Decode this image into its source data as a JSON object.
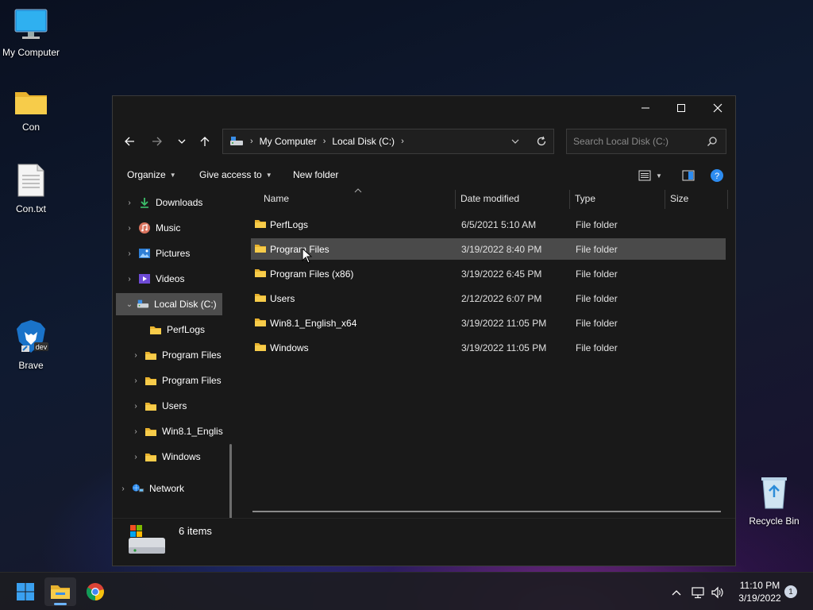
{
  "desktop": {
    "icons": [
      {
        "label": "My Computer"
      },
      {
        "label": "Con"
      },
      {
        "label": "Con.txt"
      },
      {
        "label": "Brave",
        "tag": "dev"
      },
      {
        "label": "Recycle Bin"
      }
    ]
  },
  "window": {
    "address": {
      "crumbs": [
        "My Computer",
        "Local Disk (C:)"
      ]
    },
    "search": {
      "placeholder": "Search Local Disk (C:)"
    },
    "toolbar": {
      "organize": "Organize",
      "give_access": "Give access to",
      "new_folder": "New folder"
    },
    "sidebar": {
      "items": [
        {
          "label": "Downloads",
          "icon": "download-icon"
        },
        {
          "label": "Music",
          "icon": "music-icon"
        },
        {
          "label": "Pictures",
          "icon": "pictures-icon"
        },
        {
          "label": "Videos",
          "icon": "videos-icon"
        },
        {
          "label": "Local Disk (C:)",
          "icon": "drive-icon",
          "selected": true,
          "expanded": true
        },
        {
          "label": "PerfLogs",
          "icon": "folder-icon"
        },
        {
          "label": "Program Files",
          "icon": "folder-icon"
        },
        {
          "label": "Program Files",
          "icon": "folder-icon"
        },
        {
          "label": "Users",
          "icon": "folder-icon"
        },
        {
          "label": "Win8.1_Englis",
          "icon": "folder-icon"
        },
        {
          "label": "Windows",
          "icon": "folder-icon"
        },
        {
          "label": "Network",
          "icon": "network-icon"
        }
      ]
    },
    "columns": {
      "name": "Name",
      "date": "Date modified",
      "type": "Type",
      "size": "Size"
    },
    "files": [
      {
        "name": "PerfLogs",
        "date": "6/5/2021 5:10 AM",
        "type": "File folder"
      },
      {
        "name": "Program Files",
        "date": "3/19/2022 8:40 PM",
        "type": "File folder"
      },
      {
        "name": "Program Files (x86)",
        "date": "3/19/2022 6:45 PM",
        "type": "File folder"
      },
      {
        "name": "Users",
        "date": "2/12/2022 6:07 PM",
        "type": "File folder"
      },
      {
        "name": "Win8.1_English_x64",
        "date": "3/19/2022 11:05 PM",
        "type": "File folder"
      },
      {
        "name": "Windows",
        "date": "3/19/2022 11:05 PM",
        "type": "File folder"
      }
    ],
    "status": {
      "count": "6 items"
    }
  },
  "taskbar": {
    "time": "11:10 PM",
    "date": "3/19/2022",
    "notification_count": "1"
  },
  "colors": {
    "window_bg": "#191919",
    "selection": "#4d4d4d",
    "folder": "#f5c242",
    "accent": "#2d8cf0"
  }
}
